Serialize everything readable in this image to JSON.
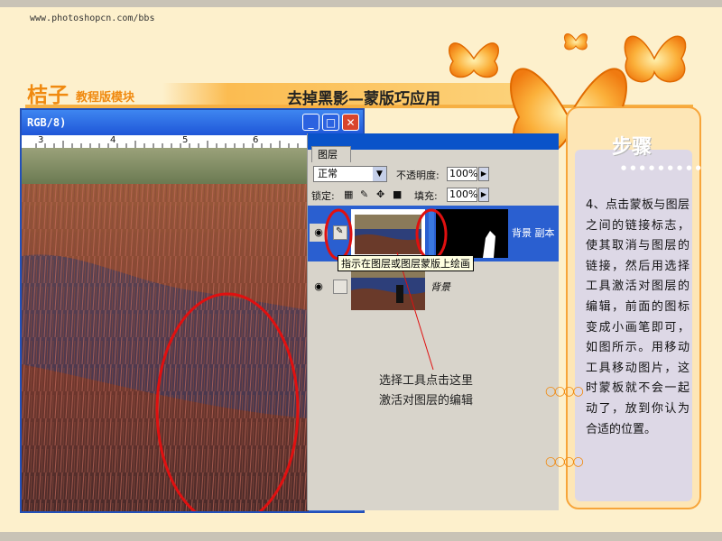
{
  "site": {
    "url": "www.photoshopcn.com/bbs",
    "logo": "桔子",
    "subtitle": "教程版模块"
  },
  "page_title": "去掉黑影—蒙版巧应用",
  "window": {
    "title": "RGB/8)",
    "ruler_ticks": [
      "3",
      "4",
      "5",
      "6"
    ],
    "buttons": {
      "min": "_",
      "max": "□",
      "close": "✕"
    }
  },
  "layers_panel": {
    "tab": "图层",
    "blend_mode": "正常",
    "opacity_label": "不透明度:",
    "opacity_value": "100%",
    "lock_label": "锁定:",
    "fill_label": "填充:",
    "fill_value": "100%",
    "layers": [
      {
        "name": "背景 副本",
        "selected": true
      },
      {
        "name": "背景",
        "selected": false
      }
    ],
    "tooltip": "指示在图层或图层蒙版上绘画"
  },
  "annotation": {
    "line1": "选择工具点击这里",
    "line2": "激活对图层的编辑"
  },
  "steps": {
    "title": "步骤",
    "text": "4、点击蒙板与图层之间的链接标志，使其取消与图层的链接，然后用选择工具激活对图层的编辑，前面的图标变成小画笔即可，如图所示。用移动工具移动图片，这时蒙板就不会一起动了，放到你认为合适的位置。"
  },
  "colors": {
    "accent": "#f08a10",
    "selected_layer": "#2a5fd0",
    "annotation_red": "#e01010"
  }
}
